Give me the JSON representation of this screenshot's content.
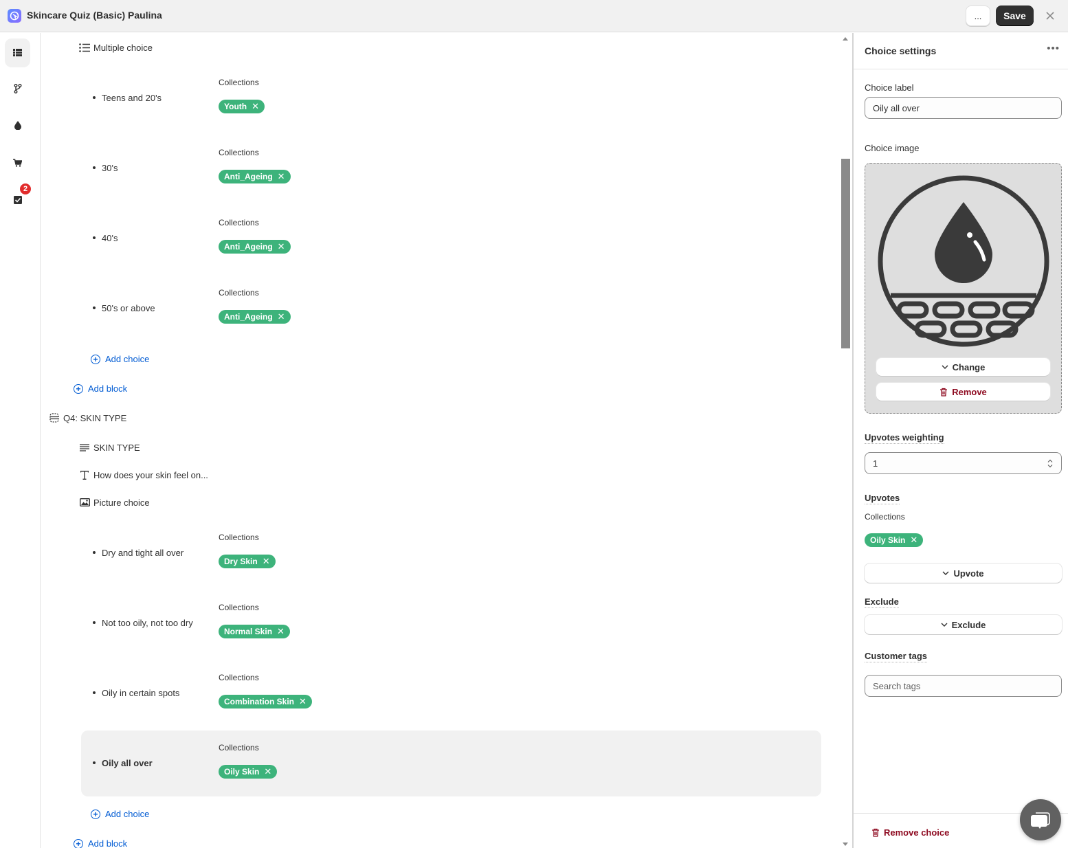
{
  "window": {
    "title": "Skincare Quiz (Basic) Paulina"
  },
  "toolbar": {
    "more_label": "...",
    "save_label": "Save",
    "close_icon": "close-icon"
  },
  "leftnav": {
    "items": [
      {
        "name": "blocks",
        "icon": "list-icon",
        "active": true
      },
      {
        "name": "logic",
        "icon": "branch-icon"
      },
      {
        "name": "theme",
        "icon": "drop-icon"
      },
      {
        "name": "products",
        "icon": "cart-icon"
      },
      {
        "name": "tasks",
        "icon": "checkbox-icon",
        "badge": "2"
      }
    ]
  },
  "tree": {
    "block1": {
      "type_label": "Multiple choice",
      "choices": [
        {
          "label": "Teens and 20's",
          "collections_label": "Collections",
          "tags": [
            "Youth"
          ]
        },
        {
          "label": "30's",
          "collections_label": "Collections",
          "tags": [
            "Anti_Ageing"
          ]
        },
        {
          "label": "40's",
          "collections_label": "Collections",
          "tags": [
            "Anti_Ageing"
          ]
        },
        {
          "label": "50's or above",
          "collections_label": "Collections",
          "tags": [
            "Anti_Ageing"
          ]
        }
      ],
      "add_choice": "Add choice",
      "add_block": "Add block"
    },
    "question": {
      "label": "Q4: SKIN TYPE"
    },
    "block2": {
      "heading_label": "SKIN TYPE",
      "text_label": "How does your skin feel on...",
      "type_label": "Picture choice",
      "choices": [
        {
          "label": "Dry and tight all over",
          "collections_label": "Collections",
          "tags": [
            "Dry Skin"
          ]
        },
        {
          "label": "Not too oily, not too dry",
          "collections_label": "Collections",
          "tags": [
            "Normal Skin"
          ]
        },
        {
          "label": "Oily in certain spots",
          "collections_label": "Collections",
          "tags": [
            "Combination Skin"
          ]
        },
        {
          "label": "Oily all over",
          "collections_label": "Collections",
          "tags": [
            "Oily Skin"
          ],
          "selected": true
        }
      ],
      "add_choice": "Add choice",
      "add_block": "Add block"
    }
  },
  "settings": {
    "title": "Choice settings",
    "more": "•••",
    "choice_label": {
      "label": "Choice label",
      "value": "Oily all over"
    },
    "choice_image": {
      "label": "Choice image",
      "change": "Change",
      "remove": "Remove"
    },
    "upvotes_weighting": {
      "label": "Upvotes weighting",
      "value": "1"
    },
    "upvotes": {
      "label": "Upvotes",
      "collections_label": "Collections",
      "tags": [
        "Oily Skin"
      ],
      "button": "Upvote"
    },
    "exclude": {
      "label": "Exclude",
      "button": "Exclude"
    },
    "customer_tags": {
      "label": "Customer tags",
      "placeholder": "Search tags"
    },
    "remove_choice": "Remove choice"
  },
  "colors": {
    "chip": "#3db37b",
    "link": "#005bd3",
    "danger": "#8e0b21",
    "primary": "#303030"
  }
}
